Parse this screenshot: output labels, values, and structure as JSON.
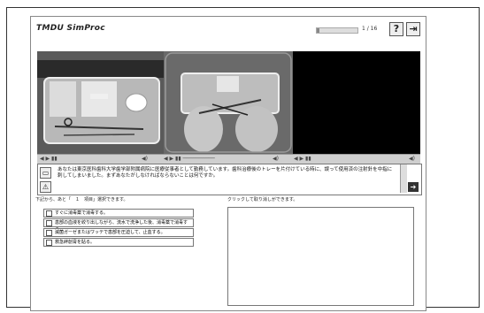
{
  "header": {
    "logo": "TMDU SimProc",
    "progress_value": 0.06,
    "counter": "1 / 16",
    "help_label": "?",
    "exit_label": "⇥"
  },
  "video": {
    "left_time": "",
    "mid_time": "",
    "right_time": ""
  },
  "question": {
    "text": "あなたは東京医科歯科大学歯学部附属病院に医療従事者として勤務しています。歯科治療後のトレーを片付けている時に、誤って使用済の注射針を中指に刺してしまいました。まずあなたがしなければならないことは何ですか。",
    "next_label": "➔"
  },
  "choices": {
    "instruction": "下記から、あと「　１　項目」選択できます。",
    "items": [
      "すぐに消毒薬で消毒する。",
      "患部の血液を絞り出しながら、流水で洗浄した後、消毒薬で消毒する。",
      "滅菌ガーゼまたはワッテで患部を圧迫して、止血する。",
      "救急絆創膏を貼る。"
    ]
  },
  "answer": {
    "instruction": "クリックして取り消しができます。"
  }
}
